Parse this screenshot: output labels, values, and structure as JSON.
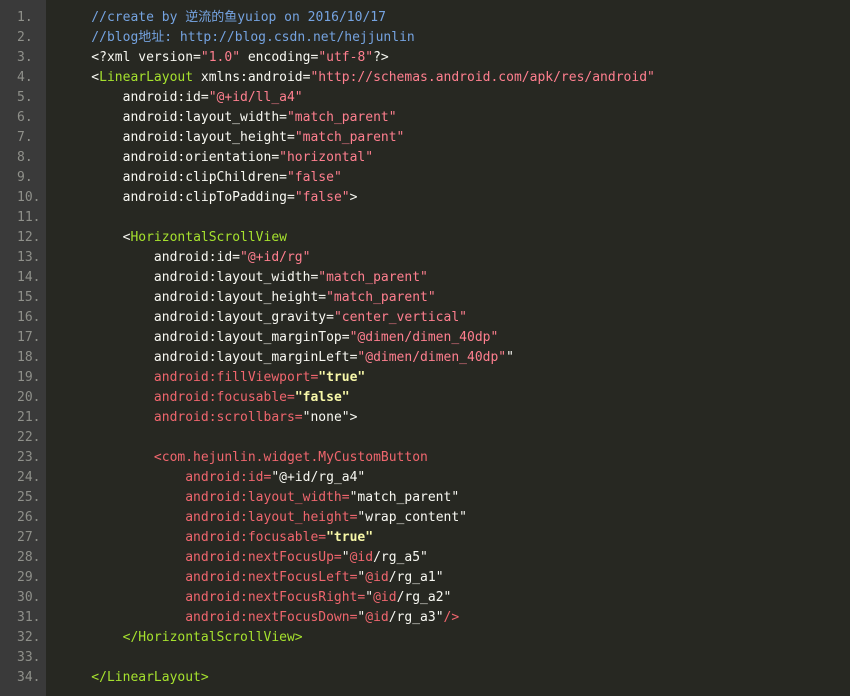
{
  "lines": [
    {
      "n": "1.",
      "parts": [
        {
          "t": "    //create by 逆流的鱼yuiop on 2016/10/17",
          "c": "c-comment"
        }
      ]
    },
    {
      "n": "2.",
      "parts": [
        {
          "t": "    //blog地址: http://blog.csdn.net/hejjunlin",
          "c": "c-comment"
        }
      ]
    },
    {
      "n": "3.",
      "parts": [
        {
          "t": "    <?xml version=",
          "c": "c-plain"
        },
        {
          "t": "\"1.0\"",
          "c": "c-pink"
        },
        {
          "t": " encoding=",
          "c": "c-plain"
        },
        {
          "t": "\"utf-8\"",
          "c": "c-pink"
        },
        {
          "t": "?>",
          "c": "c-plain"
        }
      ]
    },
    {
      "n": "4.",
      "parts": [
        {
          "t": "    <",
          "c": "c-plain"
        },
        {
          "t": "LinearLayout",
          "c": "c-tag"
        },
        {
          "t": " xmlns:android=",
          "c": "c-plain"
        },
        {
          "t": "\"http://schemas.android.com/apk/res/android\"",
          "c": "c-pink"
        }
      ]
    },
    {
      "n": "5.",
      "parts": [
        {
          "t": "        android:id=",
          "c": "c-plain"
        },
        {
          "t": "\"@+id/ll_a4\"",
          "c": "c-pink"
        }
      ]
    },
    {
      "n": "6.",
      "parts": [
        {
          "t": "        android:layout_width=",
          "c": "c-plain"
        },
        {
          "t": "\"match_parent\"",
          "c": "c-pink"
        }
      ]
    },
    {
      "n": "7.",
      "parts": [
        {
          "t": "        android:layout_height=",
          "c": "c-plain"
        },
        {
          "t": "\"match_parent\"",
          "c": "c-pink"
        }
      ]
    },
    {
      "n": "8.",
      "parts": [
        {
          "t": "        android:orientation=",
          "c": "c-plain"
        },
        {
          "t": "\"horizontal\"",
          "c": "c-pink"
        }
      ]
    },
    {
      "n": "9.",
      "parts": [
        {
          "t": "        android:clipChildren=",
          "c": "c-plain"
        },
        {
          "t": "\"false\"",
          "c": "c-pink"
        }
      ]
    },
    {
      "n": "10.",
      "parts": [
        {
          "t": "        android:clipToPadding=",
          "c": "c-plain"
        },
        {
          "t": "\"false\"",
          "c": "c-pink"
        },
        {
          "t": ">",
          "c": "c-plain"
        }
      ]
    },
    {
      "n": "11.",
      "parts": [
        {
          "t": "",
          "c": "c-plain"
        }
      ]
    },
    {
      "n": "12.",
      "parts": [
        {
          "t": "        <",
          "c": "c-plain"
        },
        {
          "t": "HorizontalScrollView",
          "c": "c-tag"
        }
      ]
    },
    {
      "n": "13.",
      "parts": [
        {
          "t": "            android:id=",
          "c": "c-plain"
        },
        {
          "t": "\"@+id/rg\"",
          "c": "c-pink"
        }
      ]
    },
    {
      "n": "14.",
      "parts": [
        {
          "t": "            android:layout_width=",
          "c": "c-plain"
        },
        {
          "t": "\"match_parent\"",
          "c": "c-pink"
        }
      ]
    },
    {
      "n": "15.",
      "parts": [
        {
          "t": "            android:layout_height=",
          "c": "c-plain"
        },
        {
          "t": "\"match_parent\"",
          "c": "c-pink"
        }
      ]
    },
    {
      "n": "16.",
      "parts": [
        {
          "t": "            android:layout_gravity=",
          "c": "c-plain"
        },
        {
          "t": "\"center_vertical\"",
          "c": "c-pink"
        }
      ]
    },
    {
      "n": "17.",
      "parts": [
        {
          "t": "            android:layout_marginTop=",
          "c": "c-plain"
        },
        {
          "t": "\"@dimen/dimen_40dp\"",
          "c": "c-pink"
        }
      ]
    },
    {
      "n": "18.",
      "parts": [
        {
          "t": "            android:layout_marginLeft=",
          "c": "c-plain"
        },
        {
          "t": "\"@dimen/dimen_40dp\"",
          "c": "c-pink"
        },
        {
          "t": "\"",
          "c": "c-plain"
        }
      ]
    },
    {
      "n": "19.",
      "parts": [
        {
          "t": "            android:fillViewport=",
          "c": "c-red"
        },
        {
          "t": "\"true\"",
          "c": "c-bold"
        }
      ]
    },
    {
      "n": "20.",
      "parts": [
        {
          "t": "            android:focusable=",
          "c": "c-red"
        },
        {
          "t": "\"false\"",
          "c": "c-bold"
        }
      ]
    },
    {
      "n": "21.",
      "parts": [
        {
          "t": "            android:scrollbars=",
          "c": "c-red"
        },
        {
          "t": "\"none\">",
          "c": "c-plain"
        }
      ]
    },
    {
      "n": "22.",
      "parts": [
        {
          "t": "",
          "c": "c-plain"
        }
      ]
    },
    {
      "n": "23.",
      "parts": [
        {
          "t": "            <com.hejunlin.widget.MyCustomButton",
          "c": "c-red"
        }
      ]
    },
    {
      "n": "24.",
      "parts": [
        {
          "t": "                android:id=",
          "c": "c-red"
        },
        {
          "t": "\"@+id/rg_a4\"",
          "c": "c-plain"
        }
      ]
    },
    {
      "n": "25.",
      "parts": [
        {
          "t": "                android:layout_width=",
          "c": "c-red"
        },
        {
          "t": "\"match_parent\"",
          "c": "c-plain"
        }
      ]
    },
    {
      "n": "26.",
      "parts": [
        {
          "t": "                android:layout_height=",
          "c": "c-red"
        },
        {
          "t": "\"wrap_content\"",
          "c": "c-plain"
        }
      ]
    },
    {
      "n": "27.",
      "parts": [
        {
          "t": "                android:focusable=",
          "c": "c-red"
        },
        {
          "t": "\"true\"",
          "c": "c-bold"
        }
      ]
    },
    {
      "n": "28.",
      "parts": [
        {
          "t": "                android:nextFocusUp=",
          "c": "c-red"
        },
        {
          "t": "\"",
          "c": "c-plain"
        },
        {
          "t": "@id",
          "c": "c-red"
        },
        {
          "t": "/rg_a5\"",
          "c": "c-plain"
        }
      ]
    },
    {
      "n": "29.",
      "parts": [
        {
          "t": "                android:nextFocusLeft=",
          "c": "c-red"
        },
        {
          "t": "\"",
          "c": "c-plain"
        },
        {
          "t": "@id",
          "c": "c-red"
        },
        {
          "t": "/rg_a1\"",
          "c": "c-plain"
        }
      ]
    },
    {
      "n": "30.",
      "parts": [
        {
          "t": "                android:nextFocusRight=",
          "c": "c-red"
        },
        {
          "t": "\"",
          "c": "c-plain"
        },
        {
          "t": "@id",
          "c": "c-red"
        },
        {
          "t": "/rg_a2\"",
          "c": "c-plain"
        }
      ]
    },
    {
      "n": "31.",
      "parts": [
        {
          "t": "                android:nextFocusDown=",
          "c": "c-red"
        },
        {
          "t": "\"",
          "c": "c-plain"
        },
        {
          "t": "@id",
          "c": "c-red"
        },
        {
          "t": "/rg_a3\"",
          "c": "c-plain"
        },
        {
          "t": "/>",
          "c": "c-red"
        }
      ]
    },
    {
      "n": "32.",
      "parts": [
        {
          "t": "        </HorizontalScrollView>",
          "c": "c-tag"
        }
      ]
    },
    {
      "n": "33.",
      "parts": [
        {
          "t": "",
          "c": "c-plain"
        }
      ]
    },
    {
      "n": "34.",
      "parts": [
        {
          "t": "    </LinearLayout>",
          "c": "c-tag"
        }
      ]
    }
  ]
}
